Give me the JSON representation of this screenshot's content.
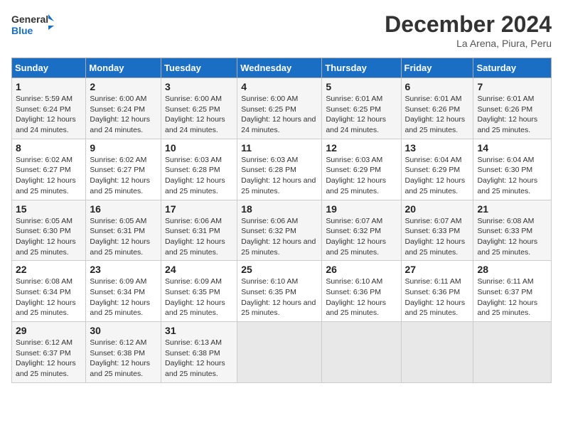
{
  "header": {
    "logo_line1": "General",
    "logo_line2": "Blue",
    "month": "December 2024",
    "location": "La Arena, Piura, Peru"
  },
  "weekdays": [
    "Sunday",
    "Monday",
    "Tuesday",
    "Wednesday",
    "Thursday",
    "Friday",
    "Saturday"
  ],
  "weeks": [
    [
      {
        "day": "1",
        "sunrise": "5:59 AM",
        "sunset": "6:24 PM",
        "daylight": "12 hours and 24 minutes."
      },
      {
        "day": "2",
        "sunrise": "6:00 AM",
        "sunset": "6:24 PM",
        "daylight": "12 hours and 24 minutes."
      },
      {
        "day": "3",
        "sunrise": "6:00 AM",
        "sunset": "6:25 PM",
        "daylight": "12 hours and 24 minutes."
      },
      {
        "day": "4",
        "sunrise": "6:00 AM",
        "sunset": "6:25 PM",
        "daylight": "12 hours and 24 minutes."
      },
      {
        "day": "5",
        "sunrise": "6:01 AM",
        "sunset": "6:25 PM",
        "daylight": "12 hours and 24 minutes."
      },
      {
        "day": "6",
        "sunrise": "6:01 AM",
        "sunset": "6:26 PM",
        "daylight": "12 hours and 25 minutes."
      },
      {
        "day": "7",
        "sunrise": "6:01 AM",
        "sunset": "6:26 PM",
        "daylight": "12 hours and 25 minutes."
      }
    ],
    [
      {
        "day": "8",
        "sunrise": "6:02 AM",
        "sunset": "6:27 PM",
        "daylight": "12 hours and 25 minutes."
      },
      {
        "day": "9",
        "sunrise": "6:02 AM",
        "sunset": "6:27 PM",
        "daylight": "12 hours and 25 minutes."
      },
      {
        "day": "10",
        "sunrise": "6:03 AM",
        "sunset": "6:28 PM",
        "daylight": "12 hours and 25 minutes."
      },
      {
        "day": "11",
        "sunrise": "6:03 AM",
        "sunset": "6:28 PM",
        "daylight": "12 hours and 25 minutes."
      },
      {
        "day": "12",
        "sunrise": "6:03 AM",
        "sunset": "6:29 PM",
        "daylight": "12 hours and 25 minutes."
      },
      {
        "day": "13",
        "sunrise": "6:04 AM",
        "sunset": "6:29 PM",
        "daylight": "12 hours and 25 minutes."
      },
      {
        "day": "14",
        "sunrise": "6:04 AM",
        "sunset": "6:30 PM",
        "daylight": "12 hours and 25 minutes."
      }
    ],
    [
      {
        "day": "15",
        "sunrise": "6:05 AM",
        "sunset": "6:30 PM",
        "daylight": "12 hours and 25 minutes."
      },
      {
        "day": "16",
        "sunrise": "6:05 AM",
        "sunset": "6:31 PM",
        "daylight": "12 hours and 25 minutes."
      },
      {
        "day": "17",
        "sunrise": "6:06 AM",
        "sunset": "6:31 PM",
        "daylight": "12 hours and 25 minutes."
      },
      {
        "day": "18",
        "sunrise": "6:06 AM",
        "sunset": "6:32 PM",
        "daylight": "12 hours and 25 minutes."
      },
      {
        "day": "19",
        "sunrise": "6:07 AM",
        "sunset": "6:32 PM",
        "daylight": "12 hours and 25 minutes."
      },
      {
        "day": "20",
        "sunrise": "6:07 AM",
        "sunset": "6:33 PM",
        "daylight": "12 hours and 25 minutes."
      },
      {
        "day": "21",
        "sunrise": "6:08 AM",
        "sunset": "6:33 PM",
        "daylight": "12 hours and 25 minutes."
      }
    ],
    [
      {
        "day": "22",
        "sunrise": "6:08 AM",
        "sunset": "6:34 PM",
        "daylight": "12 hours and 25 minutes."
      },
      {
        "day": "23",
        "sunrise": "6:09 AM",
        "sunset": "6:34 PM",
        "daylight": "12 hours and 25 minutes."
      },
      {
        "day": "24",
        "sunrise": "6:09 AM",
        "sunset": "6:35 PM",
        "daylight": "12 hours and 25 minutes."
      },
      {
        "day": "25",
        "sunrise": "6:10 AM",
        "sunset": "6:35 PM",
        "daylight": "12 hours and 25 minutes."
      },
      {
        "day": "26",
        "sunrise": "6:10 AM",
        "sunset": "6:36 PM",
        "daylight": "12 hours and 25 minutes."
      },
      {
        "day": "27",
        "sunrise": "6:11 AM",
        "sunset": "6:36 PM",
        "daylight": "12 hours and 25 minutes."
      },
      {
        "day": "28",
        "sunrise": "6:11 AM",
        "sunset": "6:37 PM",
        "daylight": "12 hours and 25 minutes."
      }
    ],
    [
      {
        "day": "29",
        "sunrise": "6:12 AM",
        "sunset": "6:37 PM",
        "daylight": "12 hours and 25 minutes."
      },
      {
        "day": "30",
        "sunrise": "6:12 AM",
        "sunset": "6:38 PM",
        "daylight": "12 hours and 25 minutes."
      },
      {
        "day": "31",
        "sunrise": "6:13 AM",
        "sunset": "6:38 PM",
        "daylight": "12 hours and 25 minutes."
      },
      null,
      null,
      null,
      null
    ]
  ]
}
